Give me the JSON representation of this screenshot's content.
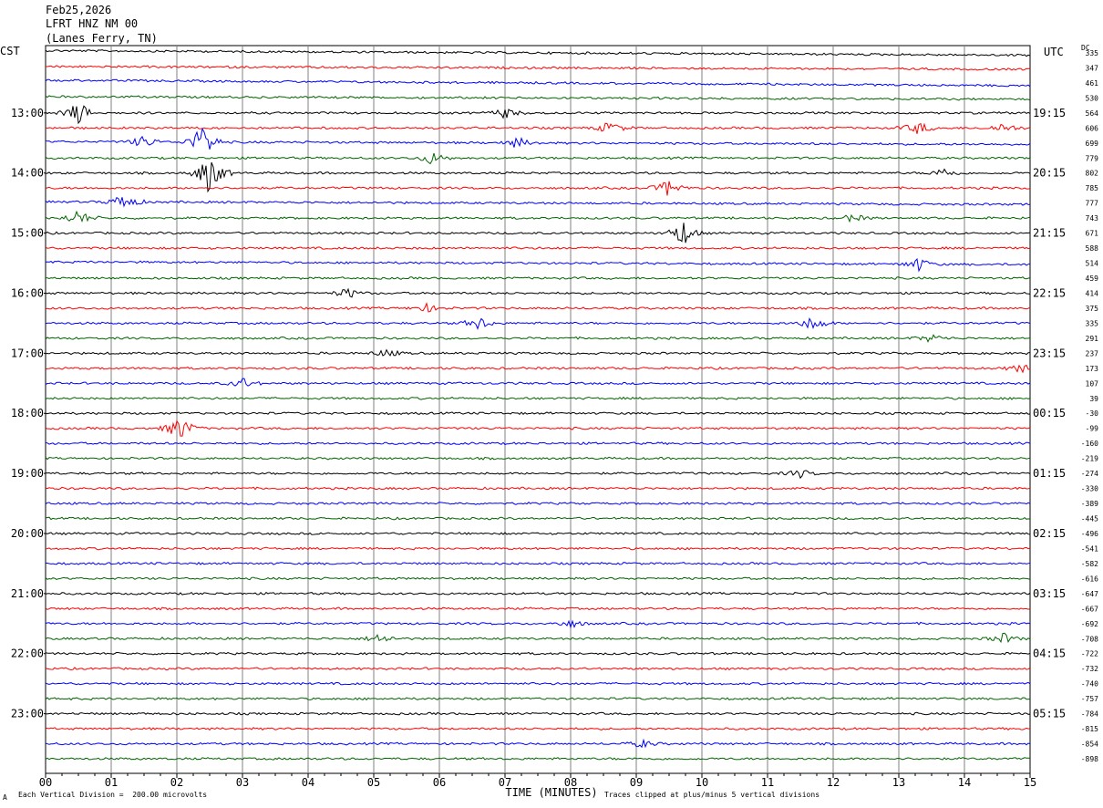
{
  "header": {
    "date": "Feb25,2026",
    "station": "LFRT HNZ NM 00",
    "location": "(Lanes Ferry, TN)"
  },
  "left_axis_label": "CST",
  "right_axis_label": "UTC",
  "dc_label": "DC",
  "footer": {
    "scale_note": "Each Vertical Division =  200.00 microvolts",
    "clip_note": "Traces clipped at plus/minus 5 vertical divisions",
    "logo_mark": "A"
  },
  "colors": {
    "trace_cycle": [
      "#000000",
      "#ff0000",
      "#0000ff",
      "#006400"
    ],
    "grid": "#808080"
  },
  "chart_data": {
    "type": "line",
    "title": "",
    "xlabel": "TIME (MINUTES)",
    "xlim": [
      0,
      15
    ],
    "x_ticks": [
      "00",
      "01",
      "02",
      "03",
      "04",
      "05",
      "06",
      "07",
      "08",
      "09",
      "10",
      "11",
      "12",
      "13",
      "14",
      "15"
    ],
    "rows": 48,
    "minutes_per_row": 15,
    "cst_labels": [
      {
        "row": 4,
        "label": "13:00"
      },
      {
        "row": 8,
        "label": "14:00"
      },
      {
        "row": 12,
        "label": "15:00"
      },
      {
        "row": 16,
        "label": "16:00"
      },
      {
        "row": 20,
        "label": "17:00"
      },
      {
        "row": 24,
        "label": "18:00"
      },
      {
        "row": 28,
        "label": "19:00"
      },
      {
        "row": 32,
        "label": "20:00"
      },
      {
        "row": 36,
        "label": "21:00"
      },
      {
        "row": 40,
        "label": "22:00"
      },
      {
        "row": 44,
        "label": "23:00"
      }
    ],
    "utc_labels": [
      {
        "row": 4,
        "label": "19:15"
      },
      {
        "row": 8,
        "label": "20:15"
      },
      {
        "row": 12,
        "label": "21:15"
      },
      {
        "row": 16,
        "label": "22:15"
      },
      {
        "row": 20,
        "label": "23:15"
      },
      {
        "row": 24,
        "label": "00:15"
      },
      {
        "row": 28,
        "label": "01:15"
      },
      {
        "row": 32,
        "label": "02:15"
      },
      {
        "row": 36,
        "label": "03:15"
      },
      {
        "row": 40,
        "label": "04:15"
      },
      {
        "row": 44,
        "label": "05:15"
      }
    ],
    "dc_offsets": [
      335,
      347,
      461,
      530,
      564,
      606,
      699,
      779,
      802,
      785,
      777,
      743,
      671,
      588,
      514,
      459,
      414,
      375,
      335,
      291,
      237,
      173,
      107,
      39,
      -30,
      -99,
      -160,
      -219,
      -274,
      -330,
      -389,
      -445,
      -496,
      -541,
      -582,
      -616,
      -647,
      -667,
      -692,
      -708,
      -722,
      -732,
      -740,
      -757,
      -784,
      -815,
      -854,
      -898
    ],
    "events": [
      {
        "row": 4,
        "minute": 0.5,
        "amplitude": 0.9
      },
      {
        "row": 4,
        "minute": 7.0,
        "amplitude": 0.4
      },
      {
        "row": 5,
        "minute": 8.6,
        "amplitude": 0.5
      },
      {
        "row": 5,
        "minute": 13.3,
        "amplitude": 0.5
      },
      {
        "row": 5,
        "minute": 14.6,
        "amplitude": 0.4
      },
      {
        "row": 6,
        "minute": 2.4,
        "amplitude": 1.4
      },
      {
        "row": 6,
        "minute": 1.5,
        "amplitude": 0.5
      },
      {
        "row": 6,
        "minute": 7.2,
        "amplitude": 0.4
      },
      {
        "row": 7,
        "minute": 5.9,
        "amplitude": 0.5
      },
      {
        "row": 8,
        "minute": 2.5,
        "amplitude": 1.6
      },
      {
        "row": 8,
        "minute": 13.7,
        "amplitude": 0.4
      },
      {
        "row": 9,
        "minute": 9.5,
        "amplitude": 0.7
      },
      {
        "row": 10,
        "minute": 1.2,
        "amplitude": 0.7
      },
      {
        "row": 11,
        "minute": 0.5,
        "amplitude": 0.6
      },
      {
        "row": 11,
        "minute": 12.3,
        "amplitude": 0.3
      },
      {
        "row": 12,
        "minute": 9.7,
        "amplitude": 1.0
      },
      {
        "row": 14,
        "minute": 13.3,
        "amplitude": 0.5
      },
      {
        "row": 16,
        "minute": 4.6,
        "amplitude": 0.4
      },
      {
        "row": 17,
        "minute": 5.8,
        "amplitude": 0.3
      },
      {
        "row": 18,
        "minute": 6.6,
        "amplitude": 0.5
      },
      {
        "row": 18,
        "minute": 11.7,
        "amplitude": 0.6
      },
      {
        "row": 19,
        "minute": 13.5,
        "amplitude": 0.3
      },
      {
        "row": 20,
        "minute": 5.2,
        "amplitude": 0.3
      },
      {
        "row": 21,
        "minute": 14.9,
        "amplitude": 0.4
      },
      {
        "row": 22,
        "minute": 3.0,
        "amplitude": 0.4
      },
      {
        "row": 25,
        "minute": 2.05,
        "amplitude": 1.0
      },
      {
        "row": 28,
        "minute": 11.5,
        "amplitude": 0.3
      },
      {
        "row": 38,
        "minute": 8.0,
        "amplitude": 0.3
      },
      {
        "row": 39,
        "minute": 5.1,
        "amplitude": 0.4
      },
      {
        "row": 39,
        "minute": 14.6,
        "amplitude": 0.4
      },
      {
        "row": 46,
        "minute": 9.1,
        "amplitude": 0.3
      }
    ]
  }
}
